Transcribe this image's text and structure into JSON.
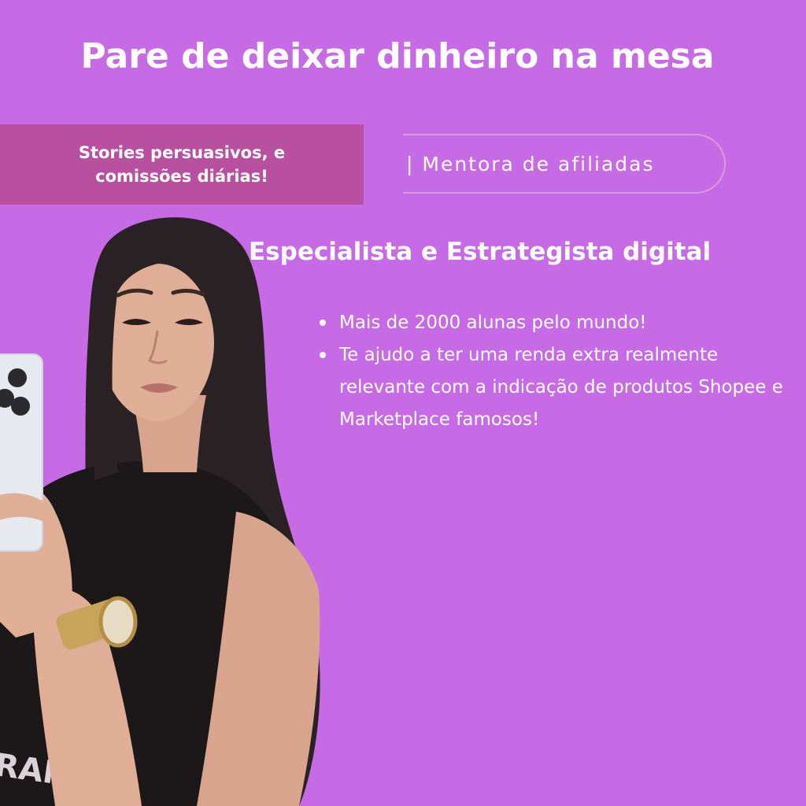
{
  "headline": "Pare de deixar dinheiro na mesa",
  "tagline": "Stories persuasivos, e comissões diárias!",
  "role": "| Mentora de afiliadas",
  "subtitle": "Especialista e Estrategista digital",
  "bullets": [
    "Mais de 2000 alunas pelo mundo!",
    "Te ajudo a ter uma renda extra realmente relevante  com a indicação de produtos Shopee e Marketplace famosos!"
  ],
  "photo": {
    "shirt_text": "RAMA"
  },
  "colors": {
    "background": "#c66ae6",
    "tagline_box": "#b9509f",
    "pill_border": "#d89ad8",
    "text": "#ffffff"
  }
}
